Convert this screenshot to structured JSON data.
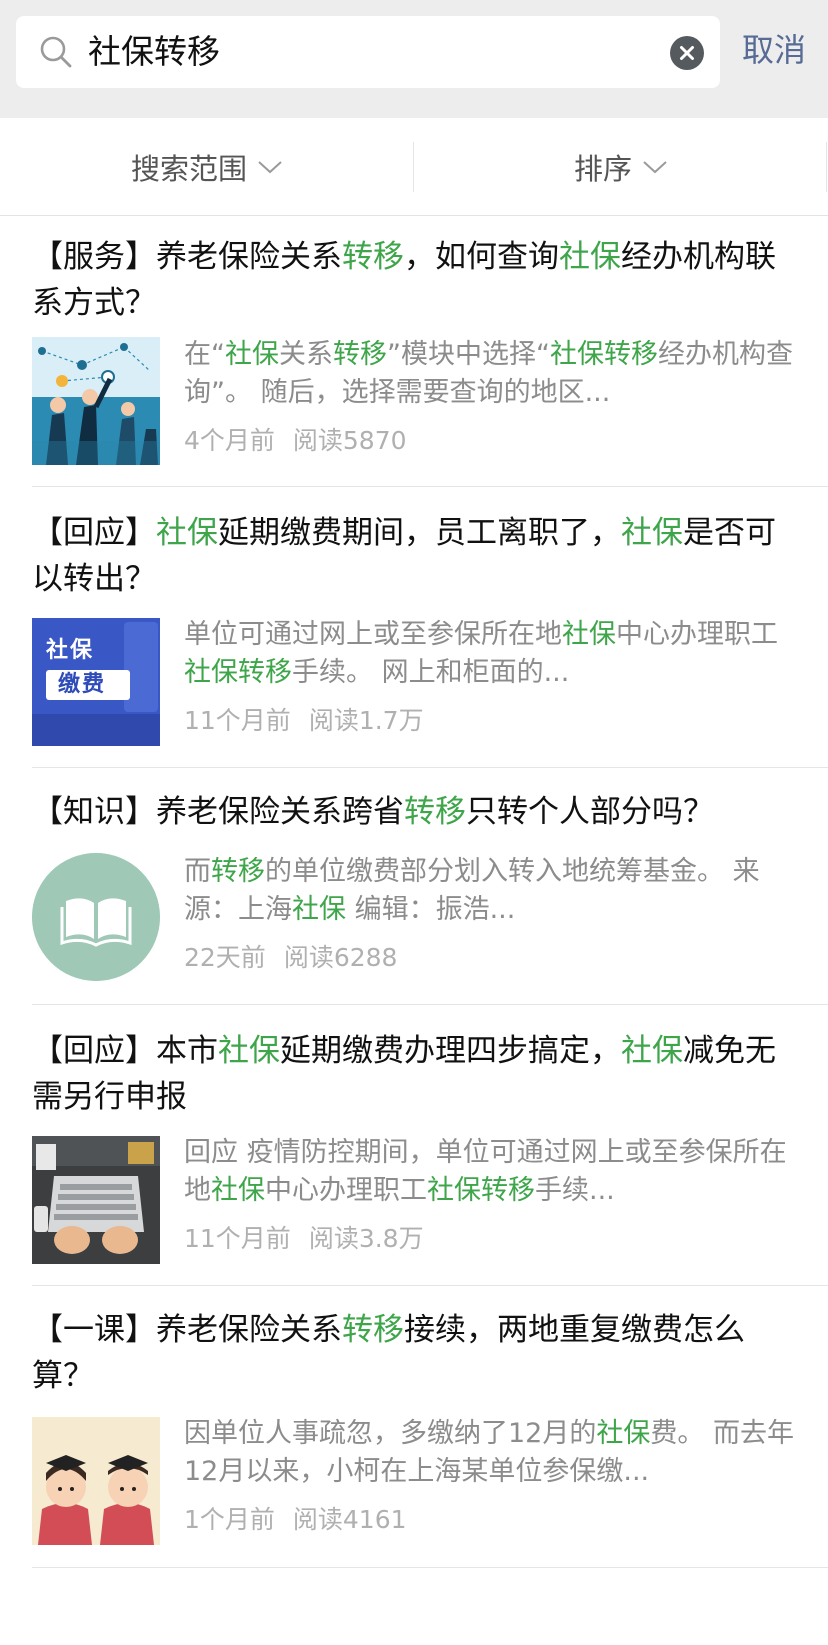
{
  "search": {
    "query": "社保转移",
    "cancel_label": "取消"
  },
  "filters": {
    "scope_label": "搜索范围",
    "sort_label": "排序"
  },
  "results": [
    {
      "title_parts": [
        {
          "t": "【服务】养老保险关系"
        },
        {
          "t": "转移",
          "hl": true
        },
        {
          "t": "，如何查询"
        },
        {
          "t": "社保",
          "hl": true
        },
        {
          "t": "经办机构联系方式？"
        }
      ],
      "snippet_parts": [
        {
          "t": "在“"
        },
        {
          "t": "社保",
          "hl": true
        },
        {
          "t": "关系"
        },
        {
          "t": "转移",
          "hl": true
        },
        {
          "t": "”模块中选择“"
        },
        {
          "t": "社保转移",
          "hl": true
        },
        {
          "t": "经办机构查询”。 随后，选择需要查询的地区..."
        }
      ],
      "time": "4个月前",
      "reads": "阅读5870",
      "thumb_icon": "business-people-network-illustration"
    },
    {
      "title_parts": [
        {
          "t": "【回应】"
        },
        {
          "t": "社保",
          "hl": true
        },
        {
          "t": "延期缴费期间，员工离职了，"
        },
        {
          "t": "社保",
          "hl": true
        },
        {
          "t": "是否可以转出？"
        }
      ],
      "snippet_parts": [
        {
          "t": "单位可通过网上或至参保所在地"
        },
        {
          "t": "社保",
          "hl": true
        },
        {
          "t": "中心办理职工"
        },
        {
          "t": "社保转移",
          "hl": true
        },
        {
          "t": "手续。 网上和柜面的..."
        }
      ],
      "time": "11个月前",
      "reads": "阅读1.7万",
      "thumb_text_1": "社保",
      "thumb_text_2": "缴费"
    },
    {
      "title_parts": [
        {
          "t": "【知识】养老保险关系跨省"
        },
        {
          "t": "转移",
          "hl": true
        },
        {
          "t": "只转个人部分吗？"
        }
      ],
      "snippet_parts": [
        {
          "t": "而"
        },
        {
          "t": "转移",
          "hl": true
        },
        {
          "t": "的单位缴费部分划入转入地统筹基金。 来源：上海"
        },
        {
          "t": "社保",
          "hl": true
        },
        {
          "t": " 编辑：振浩..."
        }
      ],
      "time": "22天前",
      "reads": "阅读6288",
      "thumb_icon": "open-book-icon"
    },
    {
      "title_parts": [
        {
          "t": "【回应】本市"
        },
        {
          "t": "社保",
          "hl": true
        },
        {
          "t": "延期缴费办理四步搞定，"
        },
        {
          "t": "社保",
          "hl": true
        },
        {
          "t": "减免无需另行申报"
        }
      ],
      "snippet_parts": [
        {
          "t": "回应 疫情防控期间，单位可通过网上或至参保所在地"
        },
        {
          "t": "社保",
          "hl": true
        },
        {
          "t": "中心办理职工"
        },
        {
          "t": "社保转移",
          "hl": true
        },
        {
          "t": "手续..."
        }
      ],
      "time": "11个月前",
      "reads": "阅读3.8万",
      "thumb_icon": "laptop-typing-photo"
    },
    {
      "title_parts": [
        {
          "t": "【一课】养老保险关系"
        },
        {
          "t": "转移",
          "hl": true
        },
        {
          "t": "接续，两地重复缴费怎么算？"
        }
      ],
      "snippet_parts": [
        {
          "t": "因单位人事疏忽，多缴纳了12月的"
        },
        {
          "t": "社保",
          "hl": true
        },
        {
          "t": "费。 而去年12月以来，小柯在上海某单位参保缴..."
        }
      ],
      "time": "1个月前",
      "reads": "阅读4161",
      "thumb_icon": "graduates-cartoon-illustration"
    }
  ],
  "colors": {
    "highlight": "#3fa54a",
    "link": "#576b95",
    "meta": "#b0b0b0",
    "snippet": "#8c8c8c"
  }
}
